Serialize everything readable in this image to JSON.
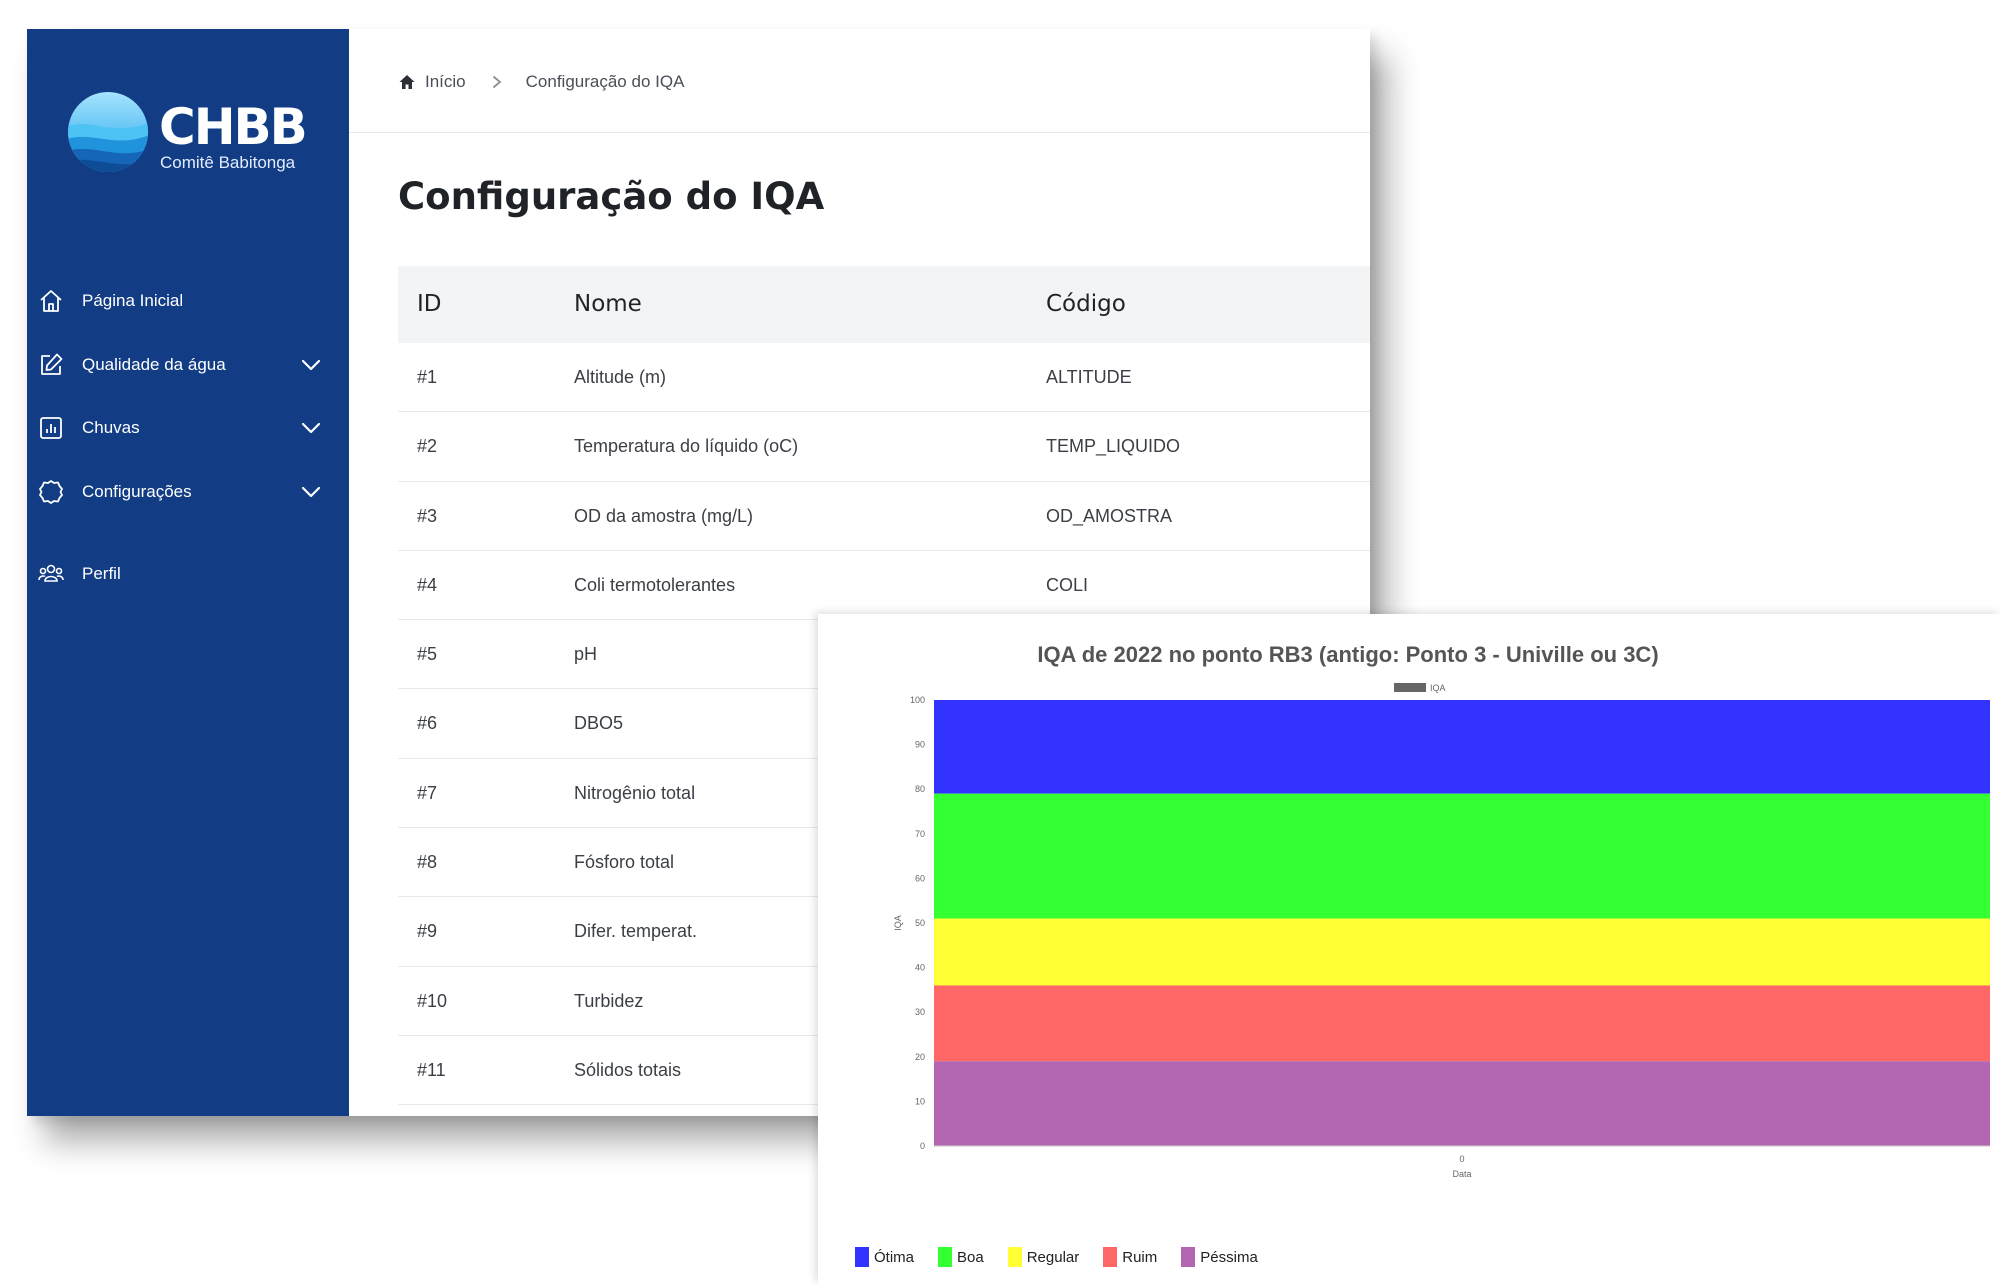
{
  "app": {
    "logo": {
      "name": "CHBB",
      "subtitle": "Comitê Babitonga"
    },
    "sidebar": {
      "items": [
        {
          "label": "Página Inicial",
          "icon": "home-icon"
        },
        {
          "label": "Qualidade da água",
          "icon": "edit-icon",
          "expandable": true
        },
        {
          "label": "Chuvas",
          "icon": "bar-chart-icon",
          "expandable": true
        },
        {
          "label": "Configurações",
          "icon": "gear-icon",
          "expandable": true
        },
        {
          "label": "Perfil",
          "icon": "users-icon"
        }
      ]
    },
    "breadcrumb": {
      "home": "Início",
      "current": "Configuração do IQA"
    },
    "page_title": "Configuração do IQA",
    "table": {
      "headers": [
        "ID",
        "Nome",
        "Código"
      ],
      "rows": [
        {
          "id": "#1",
          "nome": "Altitude (m)",
          "codigo": "ALTITUDE"
        },
        {
          "id": "#2",
          "nome": "Temperatura do líquido (oC)",
          "codigo": "TEMP_LIQUIDO"
        },
        {
          "id": "#3",
          "nome": "OD da amostra (mg/L)",
          "codigo": "OD_AMOSTRA"
        },
        {
          "id": "#4",
          "nome": "Coli termotolerantes",
          "codigo": "COLI"
        },
        {
          "id": "#5",
          "nome": "pH",
          "codigo": ""
        },
        {
          "id": "#6",
          "nome": "DBO5",
          "codigo": ""
        },
        {
          "id": "#7",
          "nome": "Nitrogênio total",
          "codigo": ""
        },
        {
          "id": "#8",
          "nome": "Fósforo total",
          "codigo": ""
        },
        {
          "id": "#9",
          "nome": "Difer. temperat.",
          "codigo": ""
        },
        {
          "id": "#10",
          "nome": "Turbidez",
          "codigo": ""
        },
        {
          "id": "#11",
          "nome": "Sólidos totais",
          "codigo": ""
        }
      ]
    },
    "colors": {
      "sidebar_bg": "#123d84",
      "accent": "#1aa3e8"
    }
  },
  "chart_data": {
    "type": "area",
    "title": "IQA de 2022 no ponto RB3 (antigo: Ponto 3 - Univille ou 3C)",
    "xlabel": "Data",
    "ylabel": "IQA",
    "categories": [
      "0"
    ],
    "ylim": [
      0,
      100
    ],
    "yticks": [
      0,
      10,
      20,
      30,
      40,
      50,
      60,
      70,
      80,
      90,
      100
    ],
    "series": [
      {
        "name": "IQA",
        "values": [],
        "color": "#666666"
      }
    ],
    "bands": [
      {
        "name": "Ótima",
        "from": 79,
        "to": 100,
        "color": "#3333ff"
      },
      {
        "name": "Boa",
        "from": 51,
        "to": 79,
        "color": "#33ff33"
      },
      {
        "name": "Regular",
        "from": 36,
        "to": 51,
        "color": "#ffff33"
      },
      {
        "name": "Ruim",
        "from": 19,
        "to": 36,
        "color": "#ff6666"
      },
      {
        "name": "Péssima",
        "from": 0,
        "to": 19,
        "color": "#b266b2"
      }
    ],
    "grid": false,
    "legend_position": "top",
    "band_legend_position": "bottom-left"
  }
}
